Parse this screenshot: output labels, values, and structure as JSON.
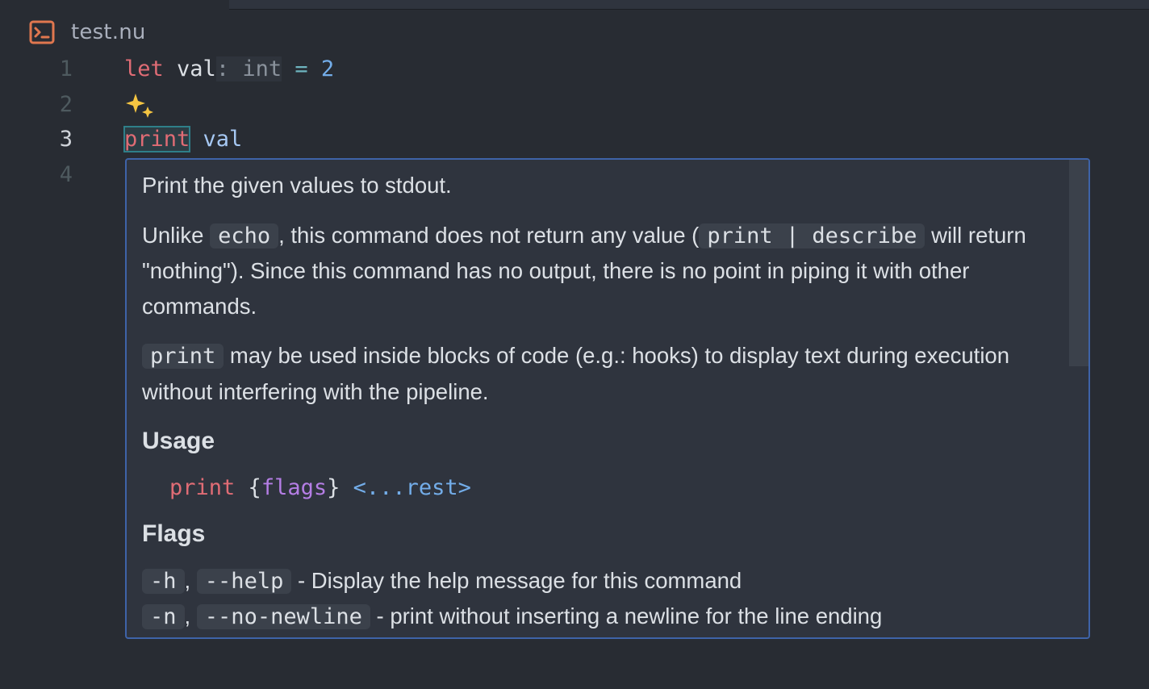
{
  "tab": {
    "title": "test.nu",
    "icon": "terminal-icon"
  },
  "gutter": {
    "lines": [
      "1",
      "2",
      "3",
      "4"
    ],
    "active_line": "3"
  },
  "code": {
    "line1": {
      "keyword": "let",
      "name": "val",
      "type_hint": ": int",
      "operator": "=",
      "value": "2"
    },
    "line2": {
      "icon": "sparkle-icon"
    },
    "line3": {
      "command": "print",
      "argument": "val"
    }
  },
  "hover": {
    "summary": "Print the given values to stdout.",
    "para1": {
      "before": "Unlike ",
      "code1": "echo",
      "middle": ", this command does not return any value (",
      "code2": "print | describe",
      "after": " will return \"nothing\"). Since this command has no output, there is no point in piping it with other commands."
    },
    "para2": {
      "code": "print",
      "text": " may be used inside blocks of code (e.g.: hooks) to display text during execution without interfering with the pipeline."
    },
    "usage_heading": "Usage",
    "usage": {
      "command": "print",
      "open_brace": "{",
      "flags": "flags",
      "close_brace": "}",
      "rest": "<...rest>"
    },
    "flags_heading": "Flags",
    "flags": [
      {
        "short": "-h",
        "long": "--help",
        "description": " - Display the help message for this command"
      },
      {
        "short": "-n",
        "long": "--no-newline",
        "description": " - print without inserting a newline for the line ending"
      }
    ]
  },
  "colors": {
    "background": "#282c33",
    "popover_bg": "#2f343e",
    "popover_border": "#3e63a8",
    "keyword": "#e06c75",
    "number": "#73ade9",
    "flags": "#b57ee5",
    "tab_icon": "#e0774f"
  }
}
